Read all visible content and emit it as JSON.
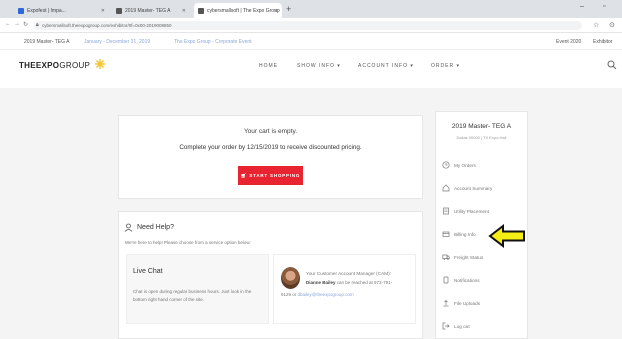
{
  "browser": {
    "tabs": [
      {
        "label": "Expofest | Impa..."
      },
      {
        "label": "2019 Master- TEG A"
      },
      {
        "label": "cybersmallsoft | The Expo Group"
      }
    ],
    "url": "cybersmallsoft.theexpogroup.com/exhibitor/0f=0x00-2019008850",
    "bookmarks": {
      "event": "2019 Master- TEG A",
      "dates": "January - December 31, 2019",
      "venue": "The Expo Group - Corporate Event",
      "right1": "Event 2020",
      "right2": "Exhibitor"
    }
  },
  "header": {
    "logo_bold": "THEEXPO",
    "logo_thin": "GROUP",
    "nav": {
      "home": "HOME",
      "show_info": "SHOW INFO ▾",
      "account_info": "ACCOUNT INFO ▾",
      "order": "ORDER ▾"
    }
  },
  "cart": {
    "empty": "Your cart is empty.",
    "complete": "Complete your order by 12/15/2019 to receive discounted pricing.",
    "start_button": "START SHOPPING"
  },
  "help": {
    "title": "Need Help?",
    "subtitle": "We're here to help! Please choose from a service option below:",
    "live_chat_title": "Live Chat",
    "live_chat_desc": "Chat is open during regular business hours. Just look in the bottom right hand corner of the site.",
    "manager_line1": "Your Customer Account Manager (CAM):",
    "manager_name": "Dianne Bailey",
    "manager_contact": "can be reached at 972-791-",
    "manager_line3_prefix": "9129 or",
    "manager_email": "dbailey@theexpogroup.com"
  },
  "side_panel": {
    "title": "2019 Master- TEG A",
    "subtitle": "Dallas 00000 | TX Expo Hall",
    "items": [
      {
        "label": "My Orders"
      },
      {
        "label": "Account Summary"
      },
      {
        "label": "Utility Placement"
      },
      {
        "label": "Billing Info"
      },
      {
        "label": "Freight Status"
      },
      {
        "label": "Notifications"
      },
      {
        "label": "File Uploads"
      },
      {
        "label": "Log out"
      }
    ]
  },
  "colors": {
    "accent_red": "#e7242f",
    "logo_yellow": "#f6c226",
    "arrow_yellow": "#f4ee14"
  }
}
